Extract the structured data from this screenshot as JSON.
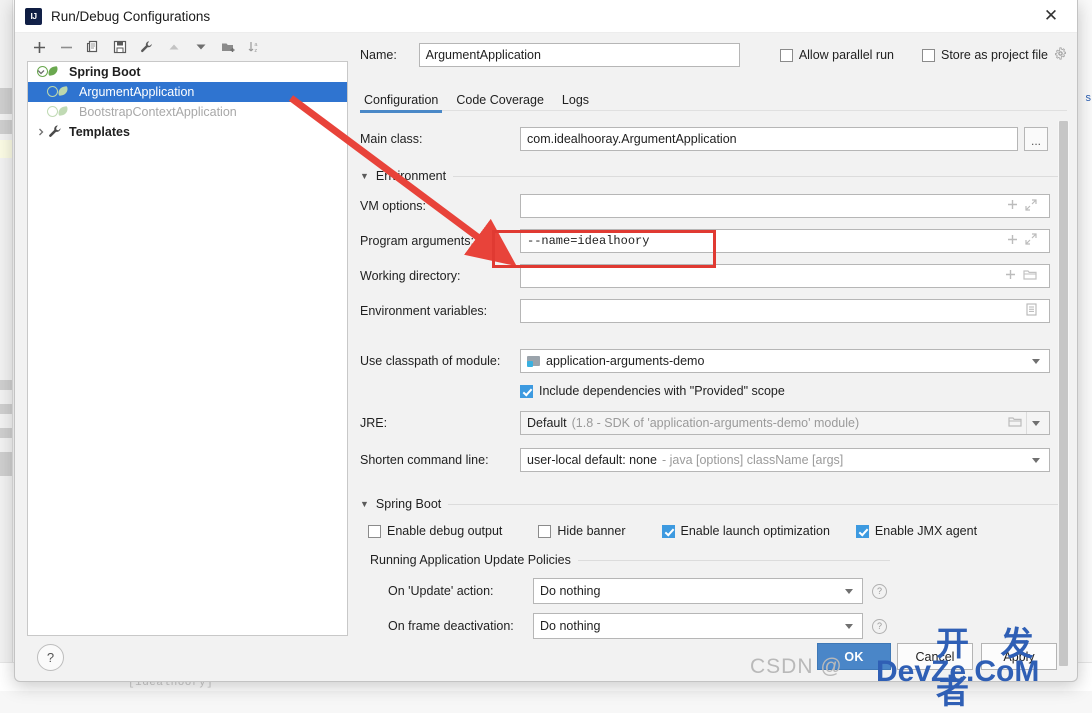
{
  "window": {
    "title": "Run/Debug Configurations",
    "logo_icon": "intellij-idea-logo",
    "close_icon": "close-icon"
  },
  "tree_toolbar": [
    {
      "name": "add-configuration-button",
      "icon": "plus-icon"
    },
    {
      "name": "remove-configuration-button",
      "icon": "minus-icon"
    },
    {
      "name": "copy-configuration-button",
      "icon": "copy-icon"
    },
    {
      "name": "save-configuration-button",
      "icon": "save-floppy-icon"
    },
    {
      "name": "edit-templates-button",
      "icon": "wrench-icon"
    },
    {
      "name": "move-up-button",
      "icon": "triangle-up-icon"
    },
    {
      "name": "move-down-button",
      "icon": "triangle-down-icon"
    },
    {
      "name": "new-folder-button",
      "icon": "folder-add-icon"
    },
    {
      "name": "sort-configurations-button",
      "icon": "sort-az-icon"
    }
  ],
  "tree": {
    "nodes": [
      {
        "label": "Spring Boot",
        "icon": "spring-boot-icon",
        "expanded": true,
        "level": 0,
        "bold": true,
        "selected": false,
        "dim": false
      },
      {
        "label": "ArgumentApplication",
        "icon": "spring-boot-icon",
        "level": 1,
        "bold": false,
        "selected": true,
        "dim": false
      },
      {
        "label": "BootstrapContextApplication",
        "icon": "spring-boot-icon",
        "level": 1,
        "bold": false,
        "selected": false,
        "dim": true
      },
      {
        "label": "Templates",
        "icon": "wrench-icon",
        "expanded": false,
        "level": 0,
        "bold": true,
        "selected": false,
        "dim": false
      }
    ]
  },
  "form": {
    "name_label": "Name:",
    "name_value": "ArgumentApplication",
    "allow_parallel_run": {
      "label": "Allow parallel run",
      "checked": false
    },
    "store_as_project_file": {
      "label": "Store as project file",
      "checked": false,
      "gear_icon": "gear-icon"
    },
    "tabs": [
      {
        "label": "Configuration",
        "active": true
      },
      {
        "label": "Code Coverage",
        "active": false
      },
      {
        "label": "Logs",
        "active": false
      }
    ],
    "main_class": {
      "label": "Main class:",
      "value": "com.idealhooray.ArgumentApplication",
      "browse_label": "..."
    },
    "environment_section": {
      "title": "Environment",
      "expanded": true
    },
    "vm_options": {
      "label": "VM options:",
      "value": "",
      "icons": [
        "plus-icon",
        "expand-icon"
      ]
    },
    "program_arguments": {
      "label": "Program arguments:",
      "value": "--name=idealhoory",
      "icons": [
        "plus-icon",
        "expand-icon"
      ]
    },
    "working_directory": {
      "label": "Working directory:",
      "value": "",
      "icons": [
        "plus-icon",
        "folder-icon"
      ]
    },
    "environment_variables": {
      "label": "Environment variables:",
      "value": "",
      "icons": [
        "list-icon"
      ]
    },
    "use_classpath_of_module": {
      "label": "Use classpath of module:",
      "value": "application-arguments-demo",
      "icon": "module-icon"
    },
    "include_provided": {
      "label": "Include dependencies with \"Provided\" scope",
      "checked": true
    },
    "jre": {
      "label": "JRE:",
      "value": "Default",
      "hint": "(1.8 - SDK of 'application-arguments-demo' module)",
      "folder_icon": "folder-icon"
    },
    "shorten_command_line": {
      "label": "Shorten command line:",
      "value": "user-local default: none",
      "hint": "- java [options] className [args]"
    },
    "spring_boot_section": {
      "title": "Spring Boot",
      "expanded": true
    },
    "spring_checkboxes": [
      {
        "label": "Enable debug output",
        "checked": false,
        "name": "enable-debug-output"
      },
      {
        "label": "Hide banner",
        "checked": false,
        "name": "hide-banner"
      },
      {
        "label": "Enable launch optimization",
        "checked": true,
        "name": "enable-launch-optimization"
      },
      {
        "label": "Enable JMX agent",
        "checked": true,
        "name": "enable-jmx-agent"
      }
    ],
    "update_policies_title": "Running Application Update Policies",
    "on_update_action": {
      "label": "On 'Update' action:",
      "value": "Do nothing",
      "help_icon": "help-icon"
    },
    "on_frame_deactivation": {
      "label": "On frame deactivation:",
      "value": "Do nothing",
      "help_icon": "help-icon"
    }
  },
  "footer": {
    "help_label": "?",
    "ok_label": "OK",
    "cancel_label": "Cancel",
    "apply_label": "Apply"
  },
  "annotations": {
    "arrow_color": "#e03a32",
    "highlight_color": "#e03a32"
  },
  "watermark": {
    "csdn": "CSDN @",
    "chinese": "开 发 者",
    "site": "DevZe.CoM"
  },
  "background": {
    "code_snippet": "[idealhoory]"
  }
}
